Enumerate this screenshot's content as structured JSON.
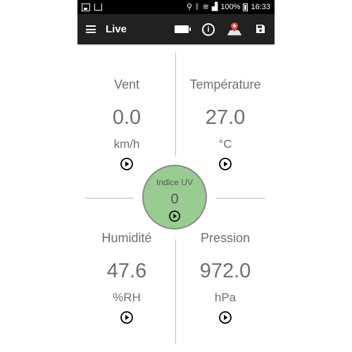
{
  "status_bar": {
    "battery_text": "100%",
    "time": "16:33"
  },
  "app_bar": {
    "title": "Live",
    "icons": [
      "menu-icon",
      "battery-icon",
      "info-icon",
      "map-pin-icon",
      "save-icon"
    ]
  },
  "readings": {
    "wind": {
      "label": "Vent",
      "value": "0.0",
      "unit": "km/h"
    },
    "temperature": {
      "label": "Température",
      "value": "27.0",
      "unit": "°C"
    },
    "humidity": {
      "label": "Humidité",
      "value": "47.6",
      "unit": "%RH"
    },
    "pressure": {
      "label": "Pression",
      "value": "972.0",
      "unit": "hPa"
    },
    "uv": {
      "label": "Indice UV",
      "value": "0"
    }
  },
  "colors": {
    "app_bar": "#212121",
    "uv_circle": "#98cc90",
    "text": "#6f6f6f"
  }
}
